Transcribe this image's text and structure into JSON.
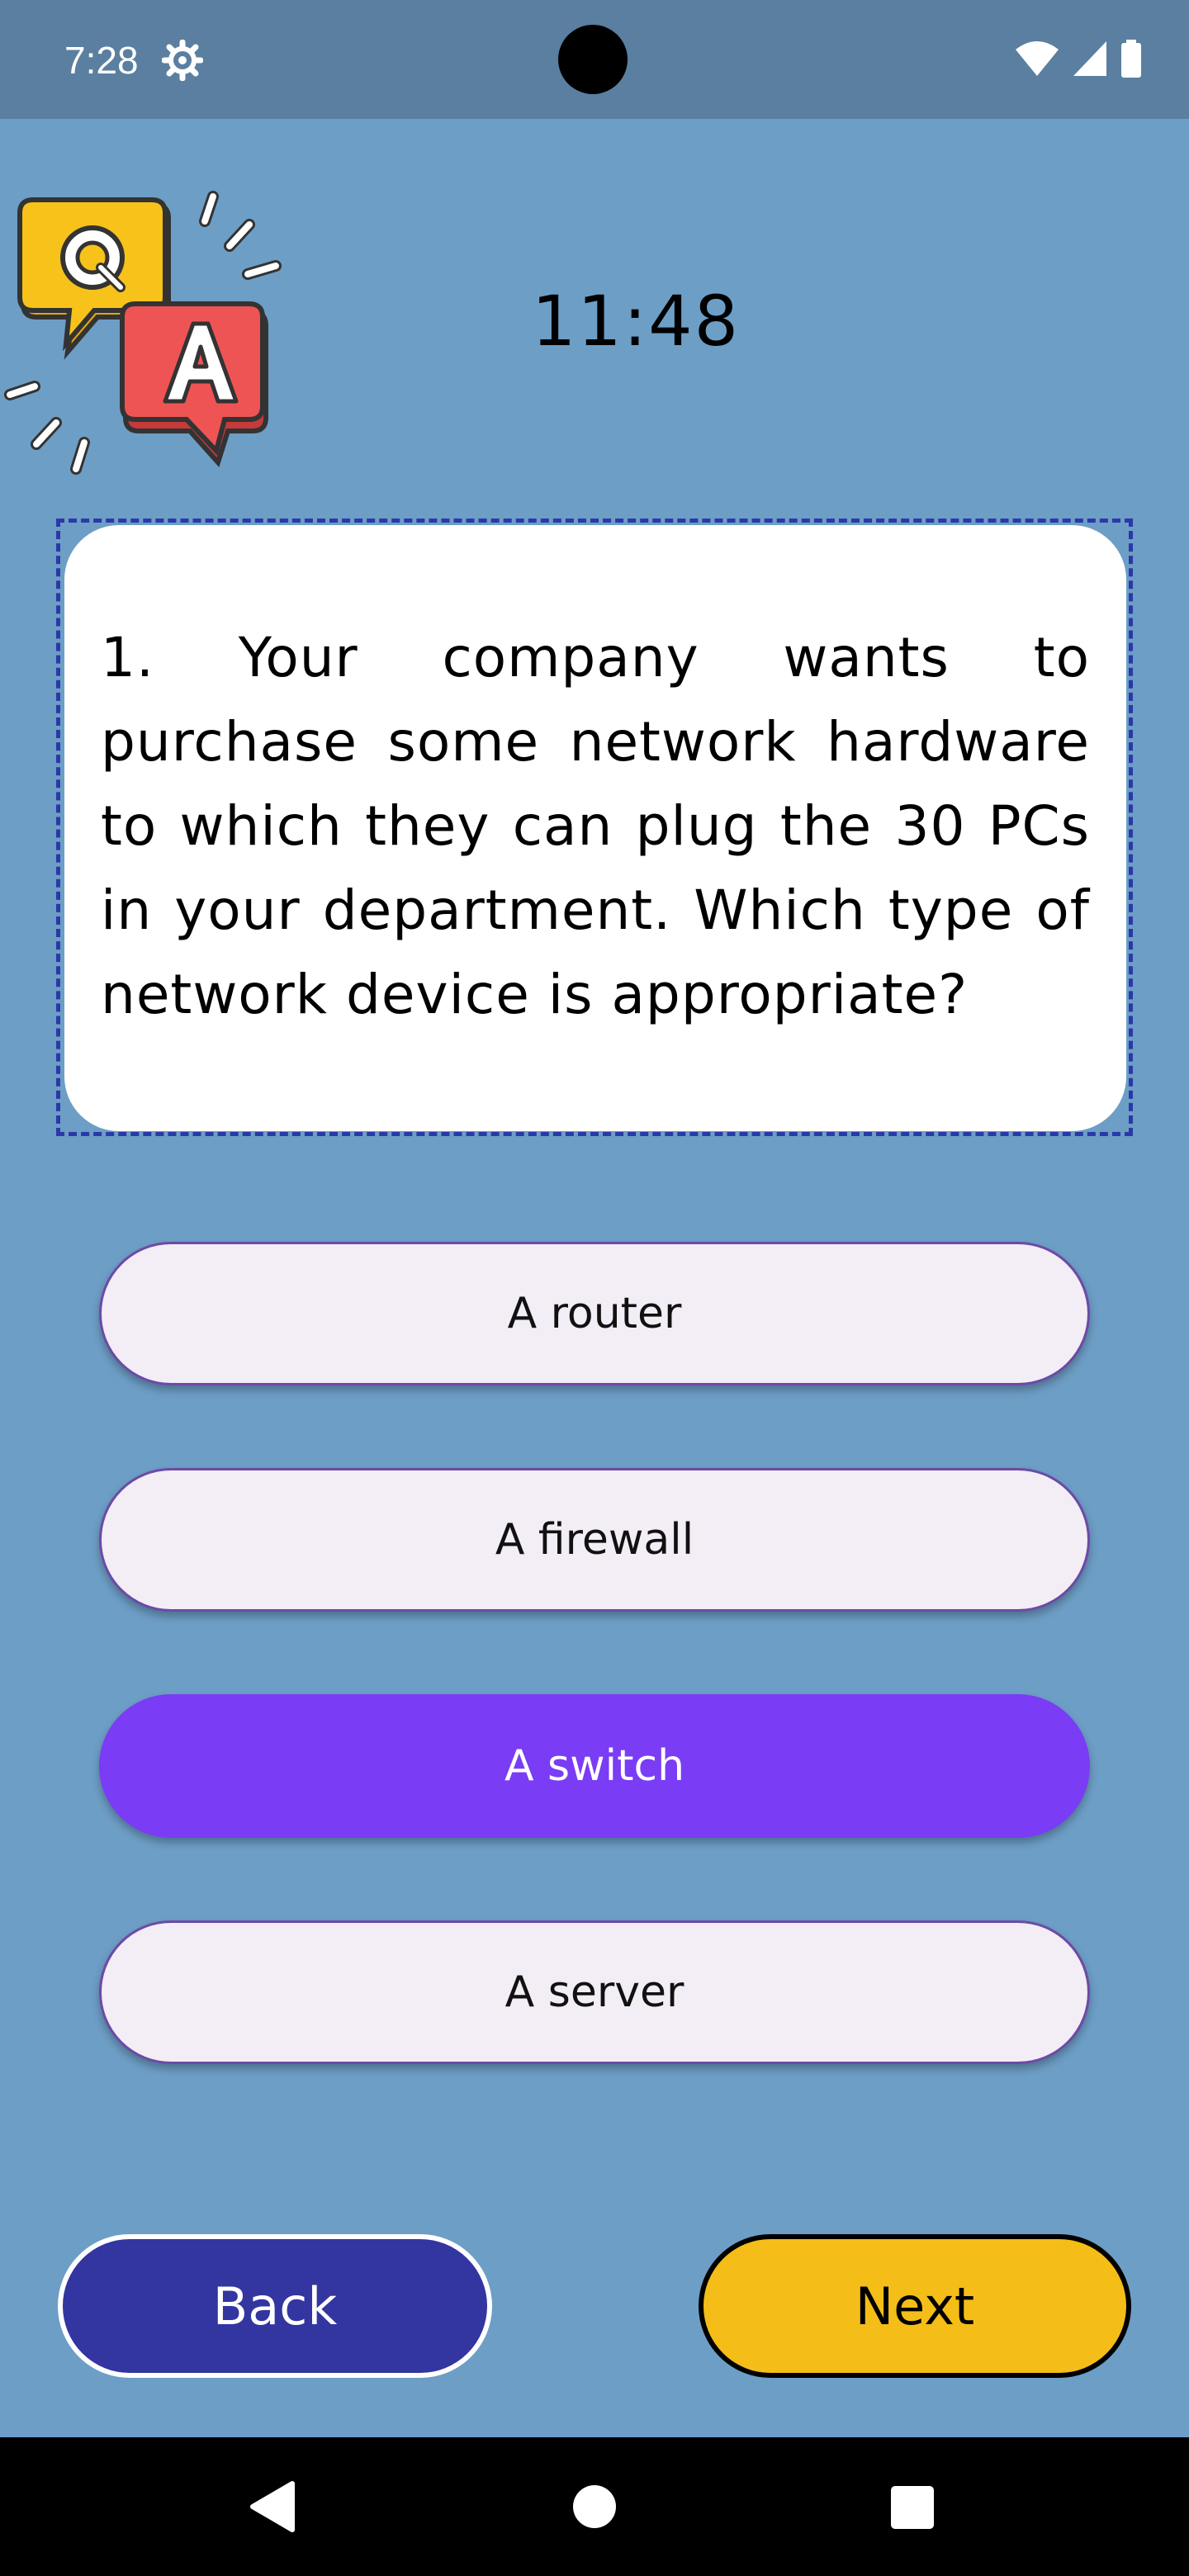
{
  "status_bar": {
    "time": "7:28"
  },
  "timer": "11:48",
  "question": {
    "text": "1. Your company wants to purchase some network hardware to which they can plug the 30 PCs in your department. Which type of network device is appropriate?"
  },
  "answers": [
    {
      "label": "A router",
      "selected": false
    },
    {
      "label": "A firewall",
      "selected": false
    },
    {
      "label": "A switch",
      "selected": true
    },
    {
      "label": "A server",
      "selected": false
    }
  ],
  "buttons": {
    "back": "Back",
    "next": "Next"
  },
  "colors": {
    "background": "#6d9ec6",
    "status_bar": "#5a7fa0",
    "selected_answer": "#7a3cf5",
    "answer_default": "#f3edf5",
    "back_button": "#3335a0",
    "next_button": "#f5bd17"
  },
  "icons": {
    "logo": "q-and-a-speech-bubbles-icon",
    "status": [
      "gear-icon",
      "wifi-icon",
      "cellular-signal-icon",
      "battery-icon"
    ],
    "nav": [
      "back-triangle-icon",
      "home-circle-icon",
      "recents-square-icon"
    ]
  }
}
